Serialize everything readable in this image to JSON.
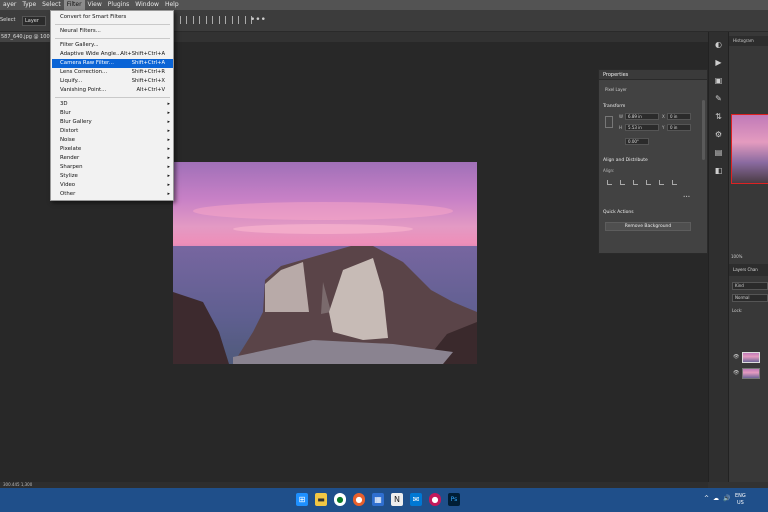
{
  "menubar": {
    "items": [
      "ayer",
      "Type",
      "Select",
      "Filter",
      "View",
      "Plugins",
      "Window",
      "Help"
    ]
  },
  "optionsbar": {
    "select_label": "Select",
    "layer_dropdown": "Layer"
  },
  "document_tab": "587_640.jpg @ 100%",
  "filter_menu": {
    "items": [
      {
        "label": "Convert for Smart Filters"
      },
      {
        "label": "Neural Filters..."
      },
      {
        "label": "Filter Gallery..."
      },
      {
        "label": "Adaptive Wide Angle...",
        "shortcut": "Alt+Shift+Ctrl+A"
      },
      {
        "label": "Camera Raw Filter...",
        "shortcut": "Shift+Ctrl+A",
        "highlighted": true
      },
      {
        "label": "Lens Correction...",
        "shortcut": "Shift+Ctrl+R"
      },
      {
        "label": "Liquify...",
        "shortcut": "Shift+Ctrl+X"
      },
      {
        "label": "Vanishing Point...",
        "shortcut": "Alt+Ctrl+V"
      },
      {
        "label": "3D",
        "submenu": true
      },
      {
        "label": "Blur",
        "submenu": true
      },
      {
        "label": "Blur Gallery",
        "submenu": true
      },
      {
        "label": "Distort",
        "submenu": true
      },
      {
        "label": "Noise",
        "submenu": true
      },
      {
        "label": "Pixelate",
        "submenu": true
      },
      {
        "label": "Render",
        "submenu": true
      },
      {
        "label": "Sharpen",
        "submenu": true
      },
      {
        "label": "Stylize",
        "submenu": true
      },
      {
        "label": "Video",
        "submenu": true
      },
      {
        "label": "Other",
        "submenu": true
      }
    ],
    "submenu_arrow": "▸"
  },
  "properties": {
    "title": "Properties",
    "layer_type": "Pixel Layer",
    "transform_title": "Transform",
    "w_label": "W",
    "w_value": "6.89 in",
    "h_label": "H",
    "h_value": "5.53 in",
    "x_label": "X",
    "x_value": "0 in",
    "y_label": "Y",
    "y_value": "0 in",
    "angle_value": "0.00°",
    "align_title": "Align and Distribute",
    "align_label": "Align:",
    "more": "•••",
    "quick_actions_title": "Quick Actions",
    "remove_bg_label": "Remove Background"
  },
  "right_panel": {
    "tabs": "Histogram",
    "zoom": "100%",
    "layers_tab": "Layers",
    "channels_tab": "Chan",
    "kind_filter": "Kind",
    "blend_mode": "Normal",
    "lock_label": "Lock:"
  },
  "status": {
    "text": "300.445 1,300"
  },
  "taskbar": {
    "lang_top": "ENG",
    "lang_bottom": "US",
    "tray_icons": [
      "^",
      "☁",
      "🔊"
    ]
  },
  "colors": {
    "highlight": "#0a64d6",
    "taskbar": "#1f4f8a",
    "photoshop_blue": "#31a8ff"
  }
}
